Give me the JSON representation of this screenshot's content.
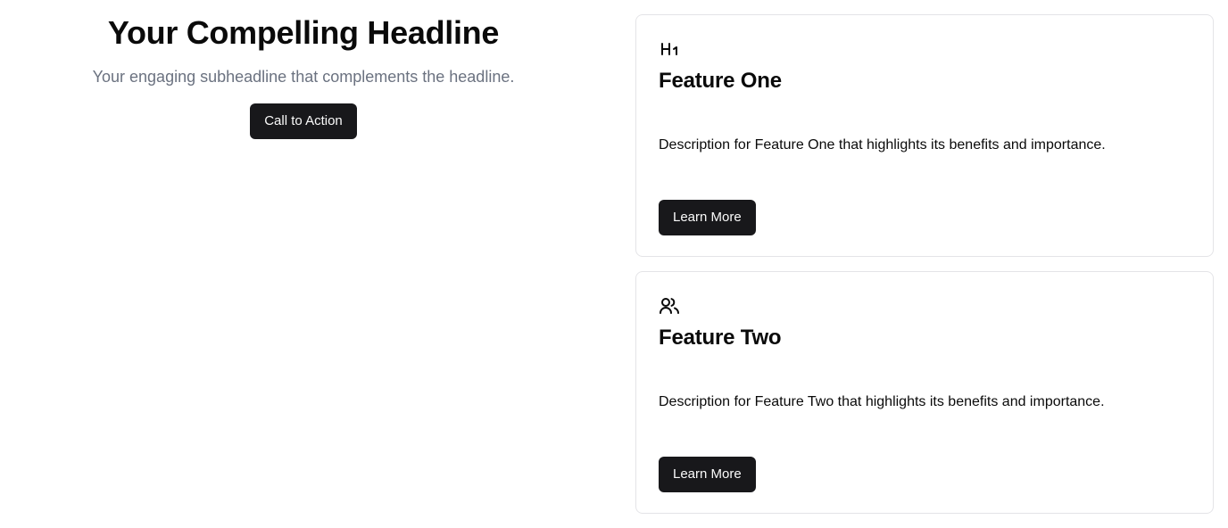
{
  "hero": {
    "title": "Your Compelling Headline",
    "subtitle": "Your engaging subheadline that complements the headline.",
    "cta_label": "Call to Action"
  },
  "features": [
    {
      "icon": "heading-1-icon",
      "title": "Feature One",
      "description": "Description for Feature One that highlights its benefits and importance.",
      "button_label": "Learn More"
    },
    {
      "icon": "users-icon",
      "title": "Feature Two",
      "description": "Description for Feature Two that highlights its benefits and importance.",
      "button_label": "Learn More"
    }
  ],
  "colors": {
    "button_bg": "#18181b",
    "button_text": "#fafafa",
    "subtitle_text": "#6b7280",
    "card_border": "#e4e4e7"
  }
}
